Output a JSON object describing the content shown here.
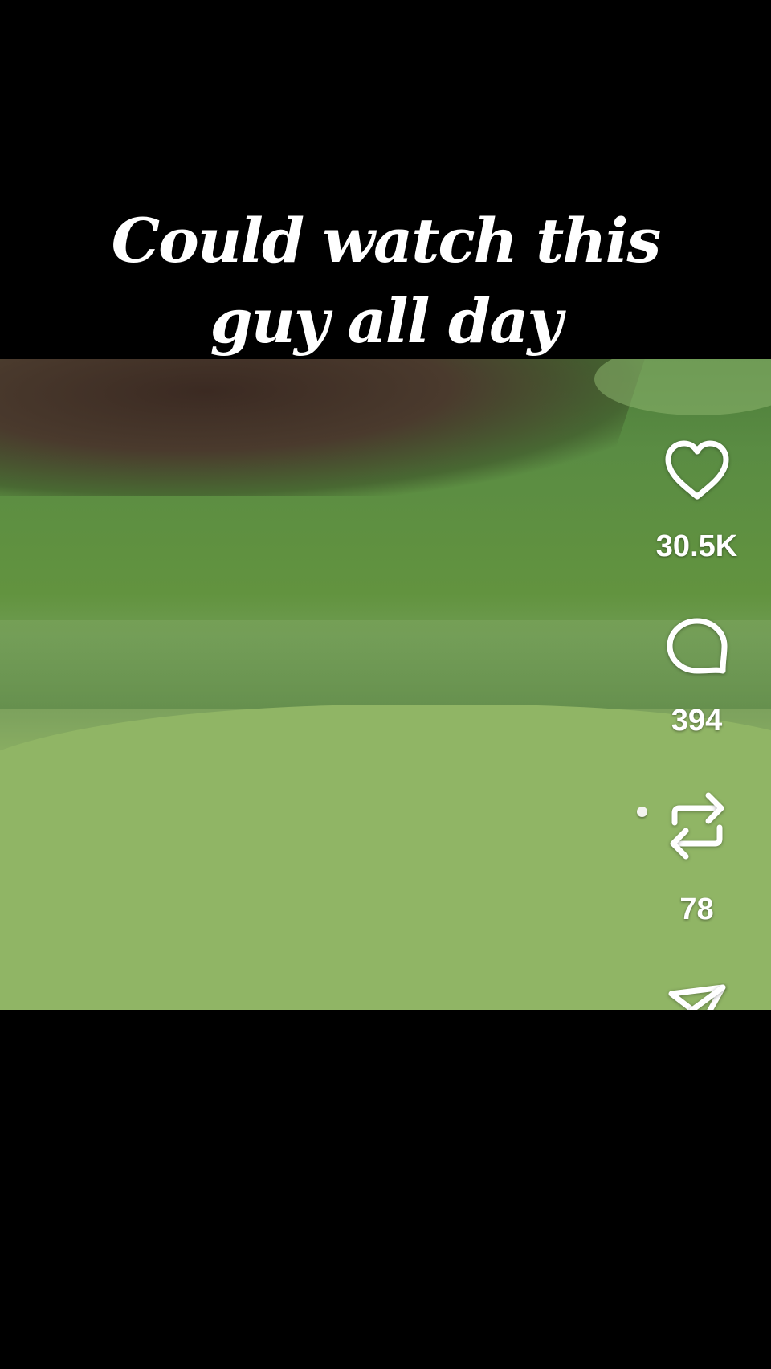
{
  "caption": {
    "line1": "Could watch this",
    "line2": "guy all day"
  },
  "actions": {
    "likes": "30.5K",
    "comments": "394",
    "reposts": "78"
  },
  "icons": {
    "like": "heart-icon",
    "comment": "comment-icon",
    "repost": "repost-icon",
    "share": "share-icon"
  },
  "colors": {
    "background": "#000000",
    "text": "#ffffff"
  }
}
